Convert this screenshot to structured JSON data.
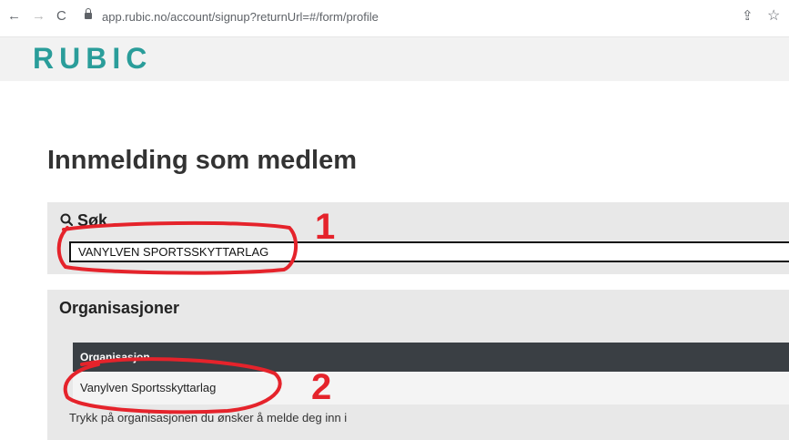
{
  "browser": {
    "url": "app.rubic.no/account/signup?returnUrl=#/form/profile",
    "back_icon": "←",
    "forward_icon": "→",
    "reload_icon": "C",
    "share_icon": "⇪",
    "star_icon": "☆"
  },
  "site": {
    "logo": "RUBIC",
    "accent": "#2a9d9a"
  },
  "page": {
    "title": "Innmelding som medlem"
  },
  "search": {
    "title": "Søk",
    "value": "VANYLVEN SPORTSSKYTTARLAG"
  },
  "organisations": {
    "title": "Organisasjoner",
    "column_header": "Organisasjon",
    "rows": [
      "Vanylven Sportsskyttarlag"
    ],
    "hint": "Trykk på organisasjonen du ønsker å melde deg inn i"
  },
  "annotations": {
    "label_1": "1",
    "label_2": "2",
    "color": "#e5232b"
  }
}
